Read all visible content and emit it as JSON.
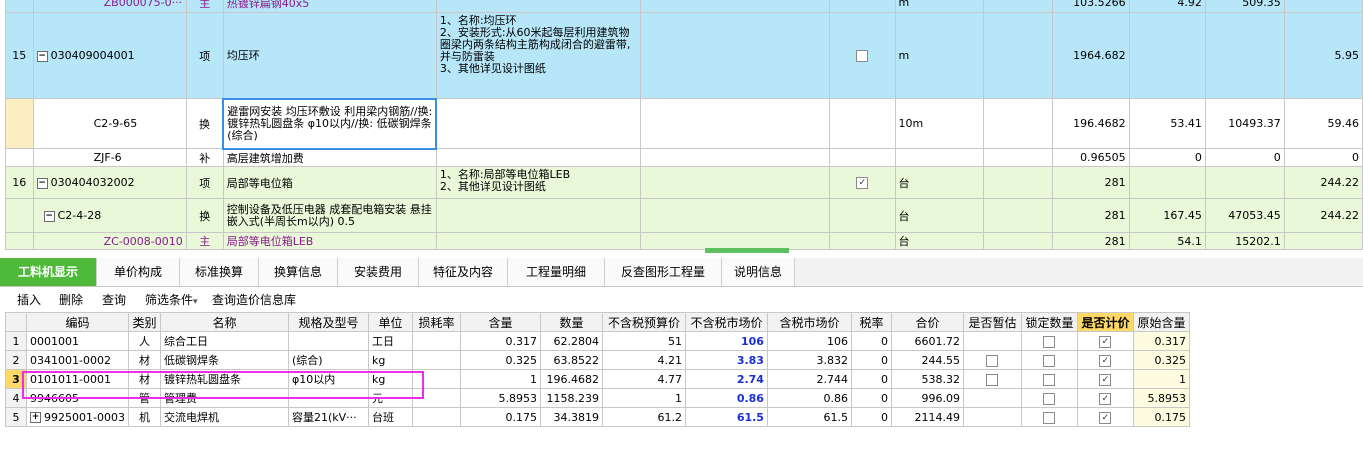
{
  "top_grid": {
    "rows": [
      {
        "num": "",
        "code": "ZB000075-0···",
        "type": "主",
        "name": "热镀锌扁钢40x5",
        "feature": "",
        "check": "",
        "unit": "m",
        "qty": "103.5266",
        "price": "4.92",
        "total": "509.35",
        "last": ""
      },
      {
        "num": "15",
        "code": "030409004001",
        "type": "项",
        "name": "均压环",
        "feature": "1、名称:均压环\n2、安装形式:从60米起每层利用建筑物圈梁内两条结构主筋构成闭合的避雷带,并与防雷装\n3、其他详见设计图纸",
        "check": "unchecked",
        "unit": "m",
        "qty": "1964.682",
        "price": "",
        "total": "",
        "last": "5.95"
      },
      {
        "num": "",
        "code": "C2-9-65",
        "type": "换",
        "name": "避雷网安装 均压环敷设 利用梁内钢筋//换: 镀锌热轧圆盘条 φ10以内//换: 低碳钢焊条 (综合)",
        "feature": "",
        "check": "",
        "unit": "10m",
        "qty": "196.4682",
        "price": "53.41",
        "total": "10493.37",
        "last": "59.46"
      },
      {
        "num": "",
        "code": "ZJF-6",
        "type": "补",
        "name": "高层建筑增加费",
        "feature": "",
        "check": "",
        "unit": "",
        "qty": "0.96505",
        "price": "0",
        "total": "0",
        "last": "0"
      },
      {
        "num": "16",
        "code": "030404032002",
        "type": "项",
        "name": "局部等电位箱",
        "feature": "1、名称:局部等电位箱LEB\n2、其他详见设计图纸",
        "check": "checked",
        "unit": "台",
        "qty": "281",
        "price": "",
        "total": "",
        "last": "244.22"
      },
      {
        "num": "",
        "code": "C2-4-28",
        "type": "换",
        "name": "控制设备及低压电器 成套配电箱安装 悬挂嵌入式(半周长m以内) 0.5",
        "feature": "",
        "check": "",
        "unit": "台",
        "qty": "281",
        "price": "167.45",
        "total": "47053.45",
        "last": "244.22"
      },
      {
        "num": "",
        "code": "ZC-0008-0010",
        "type": "主",
        "name": "局部等电位箱LEB",
        "feature": "",
        "check": "",
        "unit": "台",
        "qty": "281",
        "price": "54.1",
        "total": "15202.1",
        "last": ""
      }
    ]
  },
  "tabs": [
    "工料机显示",
    "单价构成",
    "标准换算",
    "换算信息",
    "安装费用",
    "特征及内容",
    "工程量明细",
    "反查图形工程量",
    "说明信息"
  ],
  "toolbar": {
    "insert": "插入",
    "delete": "删除",
    "query": "查询",
    "filter": "筛选条件",
    "filter_arrow": "▾",
    "query_price": "查询造价信息库"
  },
  "bottom_grid": {
    "headers": [
      "",
      "编码",
      "类别",
      "名称",
      "规格及型号",
      "单位",
      "损耗率",
      "含量",
      "数量",
      "不含税预算价",
      "不含税市场价",
      "含税市场价",
      "税率",
      "合价",
      "是否暂估",
      "锁定数量",
      "是否计价",
      "原始含量"
    ],
    "rows": [
      {
        "n": "1",
        "code": "0001001",
        "cat": "人",
        "name": "综合工日",
        "spec": "",
        "unit": "工日",
        "loss": "",
        "content": "0.317",
        "qty": "62.2804",
        "budget": "51",
        "market": "106",
        "taxmarket": "106",
        "tax": "0",
        "total": "6601.72",
        "est": "",
        "lock": "box",
        "price": "checked",
        "orig": "0.317",
        "expand": false
      },
      {
        "n": "2",
        "code": "0341001-0002",
        "cat": "材",
        "name": "低碳钢焊条",
        "spec": "(综合)",
        "unit": "kg",
        "loss": "",
        "content": "0.325",
        "qty": "63.8522",
        "budget": "4.21",
        "market": "3.83",
        "taxmarket": "3.832",
        "tax": "0",
        "total": "244.55",
        "est": "box",
        "lock": "box",
        "price": "checked",
        "orig": "0.325",
        "expand": false
      },
      {
        "n": "3",
        "code": "0101011-0001",
        "cat": "材",
        "name": "镀锌热轧圆盘条",
        "spec": "φ10以内",
        "unit": "kg",
        "loss": "",
        "content": "1",
        "qty": "196.4682",
        "budget": "4.77",
        "market": "2.74",
        "taxmarket": "2.744",
        "tax": "0",
        "total": "538.32",
        "est": "box",
        "lock": "box",
        "price": "checked",
        "orig": "1",
        "expand": false
      },
      {
        "n": "4",
        "code": "9946605",
        "cat": "管",
        "name": "管理费",
        "spec": "",
        "unit": "元",
        "loss": "",
        "content": "5.8953",
        "qty": "1158.239",
        "budget": "1",
        "market": "0.86",
        "taxmarket": "0.86",
        "tax": "0",
        "total": "996.09",
        "est": "",
        "lock": "box",
        "price": "checked",
        "orig": "5.8953",
        "expand": false
      },
      {
        "n": "5",
        "code": "9925001-0003",
        "cat": "机",
        "name": "交流电焊机",
        "spec": "容量21(kV···",
        "unit": "台班",
        "loss": "",
        "content": "0.175",
        "qty": "34.3819",
        "budget": "61.2",
        "market": "61.5",
        "taxmarket": "61.5",
        "tax": "0",
        "total": "2114.49",
        "est": "",
        "lock": "box",
        "price": "checked",
        "orig": "0.175",
        "expand": true
      }
    ]
  },
  "icons": {
    "check": "✓",
    "expand_minus": "−",
    "expand_plus": "+"
  },
  "colors": {
    "active_tab": "#4fba3a",
    "blue_row": "#b6e6f8",
    "green_row": "#e9f8d8",
    "highlight": "#ee2ee6",
    "price_blue": "#1a2fd6"
  }
}
